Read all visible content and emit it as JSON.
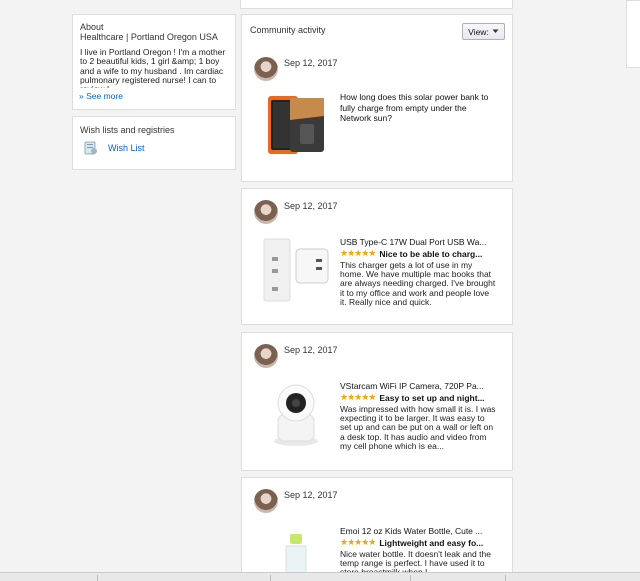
{
  "about": {
    "heading": "About",
    "subtitle": "Healthcare | Portland Oregon USA",
    "bio": "I live in Portland Oregon ! I'm a mother to 2 beautiful kids, 1 girl &amp; 1 boy and a wife to my husband . Im cardiac pulmonary registered nurse! I can to review I",
    "see_more": "» See more"
  },
  "wishlists": {
    "heading": "Wish lists and registries",
    "link": "Wish List"
  },
  "community": {
    "heading": "Community activity",
    "view_label": "View:"
  },
  "activity": [
    {
      "date": "Sep 12, 2017",
      "question": "How long does this solar power bank to fully charge from empty under the Network sun?"
    },
    {
      "date": "Sep 12, 2017",
      "product": "USB Type-C 17W Dual Port USB Wa...",
      "stars": "★★★★★",
      "headline": "Nice to be able to charg...",
      "body": "This charger gets a lot of use in my home. We have multiple mac books that are always needing charged. I've brought it to my office and work and people love it. Really nice and quick."
    },
    {
      "date": "Sep 12, 2017",
      "product": "VStarcam WiFi IP Camera, 720P Pa...",
      "stars": "★★★★★",
      "headline": "Easy to set up and night...",
      "body": "Was impressed with how small it is. I was expecting it to be larger. It was easy to set up and can be put on a wall or left on a desk top. It has audio and video from my cell phone which is ea..."
    },
    {
      "date": "Sep 12, 2017",
      "product": "Emoi 12 oz Kids Water Bottle, Cute ...",
      "stars": "★★★★★",
      "headline": "Lightweight and easy fo...",
      "body": "Nice water bottle. It doesn't leak and the temp range is perfect. I have used it to store breastmilk when I"
    }
  ],
  "icons": {
    "avatar": "avatar-photo",
    "wishlist": "wishlist-icon",
    "dropdown": "chevron-down-icon"
  },
  "colors": {
    "link": "#0066c0",
    "star": "#f0a500",
    "border": "#dddddd",
    "background": "#f3f3f3"
  }
}
